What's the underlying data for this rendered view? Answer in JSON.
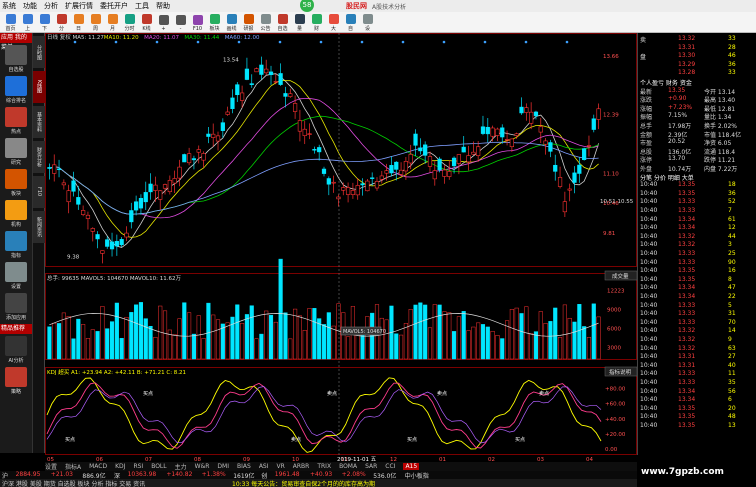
{
  "menubar": {
    "items": [
      "系统",
      "功能",
      "分析",
      "扩展行情",
      "委托开户",
      "工具",
      "帮助"
    ],
    "brand": "股民网",
    "title": "A股技术分析"
  },
  "toolbar": {
    "buttons": [
      "首页",
      "上",
      "下",
      "分",
      "日",
      "周",
      "月",
      "分时",
      "K线",
      "+",
      "-",
      "F10",
      "板块",
      "画线",
      "研报",
      "公告",
      "自选",
      "量",
      "财",
      "大",
      "自",
      "设"
    ]
  },
  "sidebar": {
    "header": "应用 我的菜单",
    "items": [
      "自选股",
      "综合排名",
      "热点",
      "研究",
      "板块",
      "机构",
      "指标",
      "设置",
      "添加应用"
    ],
    "bottom": "精品推荐",
    "apps": [
      "AI分析",
      "策略"
    ]
  },
  "vtabs": [
    "分时图",
    "K线图",
    "基本资料",
    "财务分析",
    "F10",
    "新闻资讯"
  ],
  "chart": {
    "ma_legend": [
      {
        "text": "日线 复权 MA5: 11.27",
        "color": "#d0d0d0"
      },
      {
        "text": "MA10: 11.20",
        "color": "#e6e600"
      },
      {
        "text": "MA20: 11.07",
        "color": "#e04ce0"
      },
      {
        "text": "MA30: 11.44",
        "color": "#00d000"
      },
      {
        "text": "MA60: 12.00",
        "color": "#7f9fff"
      }
    ],
    "price_axis": [
      "13.66",
      "12.39",
      "11.10",
      "10.46",
      "9.81"
    ],
    "high_label": "13.54",
    "low_label": "9.38",
    "low2_label": "10.51 10.55",
    "vol_legend": "总手: 99635  MAVOL5: 104670  MAVOL10: 11.62万",
    "vol_axis": [
      "12223",
      "9000",
      "6000",
      "3000"
    ],
    "vol_tooltip": "MAVOL5: 104670",
    "vol_btn": "成交量",
    "osc_legend": "KDJ 超买  A1: +23.94  A2: +42.11  B: +71.21  C: 8.21",
    "osc_axis": [
      "+80.00",
      "+60.00",
      "+40.00",
      "+20.00",
      "0.00"
    ],
    "osc_btn": "指标说明",
    "date_axis": [
      "05",
      "06",
      "07",
      "08",
      "09",
      "10",
      "11",
      "12",
      "01",
      "02",
      "03",
      "04"
    ],
    "date_tag": "2019-11-01 五",
    "annot": [
      "买点",
      "买点",
      "卖点",
      "卖点",
      "买点",
      "卖点",
      "买点",
      "卖点"
    ]
  },
  "btabs": [
    "设置",
    "指标A",
    "MACD",
    "KDJ",
    "RSI",
    "BOLL",
    "主力",
    "W&R",
    "DMI",
    "BIAS",
    "ASI",
    "VR",
    "ARBR",
    "TRIX",
    "BOMA",
    "SAR",
    "CCI",
    "A15"
  ],
  "rpanel": {
    "title_rows": [
      {
        "l": "卖",
        "v": "13.32",
        "r": "33"
      },
      {
        "l": "",
        "v": "13.31",
        "r": "28"
      },
      {
        "l": "盘",
        "v": "13.30",
        "r": "46"
      },
      {
        "l": "",
        "v": "13.29",
        "r": "36"
      },
      {
        "l": "",
        "v": "13.28",
        "r": "33"
      }
    ],
    "sec_title": "个人盈亏  财务 资金",
    "stats": [
      {
        "l": "最新",
        "v": "13.35",
        "r": "今开 13.14"
      },
      {
        "l": "涨跌",
        "v": "+0.90",
        "r": "最高 13.40"
      },
      {
        "l": "涨幅",
        "v": "+7.23%",
        "r": "最低 12.81"
      },
      {
        "l": "振幅",
        "v": "7.15%",
        "r": "量比 1.34"
      },
      {
        "l": "总手",
        "v": "17.98万",
        "r": "换手 2.02%"
      },
      {
        "l": "金额",
        "v": "2.39亿",
        "r": "市值 118.4亿"
      },
      {
        "l": "市盈",
        "v": "20.52",
        "r": "净资 6.05"
      },
      {
        "l": "总股",
        "v": "136.0亿",
        "r": "流通 118.4"
      },
      {
        "l": "涨停",
        "v": "13.70",
        "r": "跌停 11.21"
      },
      {
        "l": "外盘",
        "v": "10.74万",
        "r": "内盘 7.22万"
      }
    ],
    "ticks": [
      {
        "t": "10:40",
        "p": "13.35",
        "v": "18"
      },
      {
        "t": "10:40",
        "p": "13.35",
        "v": "36"
      },
      {
        "t": "10:40",
        "p": "13.33",
        "v": "52"
      },
      {
        "t": "10:40",
        "p": "13.33",
        "v": "7"
      },
      {
        "t": "10:40",
        "p": "13.34",
        "v": "61"
      },
      {
        "t": "10:40",
        "p": "13.34",
        "v": "12"
      },
      {
        "t": "10:40",
        "p": "13.32",
        "v": "44"
      },
      {
        "t": "10:40",
        "p": "13.32",
        "v": "3"
      },
      {
        "t": "10:40",
        "p": "13.33",
        "v": "25"
      },
      {
        "t": "10:40",
        "p": "13.33",
        "v": "90"
      },
      {
        "t": "10:40",
        "p": "13.35",
        "v": "16"
      },
      {
        "t": "10:40",
        "p": "13.35",
        "v": "8"
      },
      {
        "t": "10:40",
        "p": "13.34",
        "v": "47"
      },
      {
        "t": "10:40",
        "p": "13.34",
        "v": "22"
      },
      {
        "t": "10:40",
        "p": "13.33",
        "v": "5"
      },
      {
        "t": "10:40",
        "p": "13.33",
        "v": "31"
      },
      {
        "t": "10:40",
        "p": "13.33",
        "v": "70"
      },
      {
        "t": "10:40",
        "p": "13.32",
        "v": "14"
      },
      {
        "t": "10:40",
        "p": "13.32",
        "v": "9"
      },
      {
        "t": "10:40",
        "p": "13.32",
        "v": "63"
      },
      {
        "t": "10:40",
        "p": "13.31",
        "v": "27"
      },
      {
        "t": "10:40",
        "p": "13.31",
        "v": "40"
      },
      {
        "t": "10:40",
        "p": "13.33",
        "v": "11"
      },
      {
        "t": "10:40",
        "p": "13.33",
        "v": "35"
      },
      {
        "t": "10:40",
        "p": "13.34",
        "v": "56"
      },
      {
        "t": "10:40",
        "p": "13.34",
        "v": "6"
      },
      {
        "t": "10:40",
        "p": "13.35",
        "v": "20"
      },
      {
        "t": "10:40",
        "p": "13.35",
        "v": "48"
      },
      {
        "t": "10:40",
        "p": "13.35",
        "v": "13"
      }
    ],
    "tick_header": "分笔  分价  明细  大单"
  },
  "statusbar": [
    {
      "text": "沪",
      "color": "#ddd"
    },
    {
      "text": "2884.95",
      "color": "#ff4040"
    },
    {
      "text": "+21.03",
      "color": "#ff4040"
    },
    {
      "text": "886.9亿",
      "color": "#ddd"
    },
    {
      "text": "深",
      "color": "#ddd"
    },
    {
      "text": "10363.98",
      "color": "#ff4040"
    },
    {
      "text": "+140.82",
      "color": "#ff4040"
    },
    {
      "text": "+1.38%",
      "color": "#ff4040"
    },
    {
      "text": "1619亿",
      "color": "#ddd"
    },
    {
      "text": "创",
      "color": "#ddd"
    },
    {
      "text": "1961.48",
      "color": "#ff4040"
    },
    {
      "text": "+40.93",
      "color": "#ff4040"
    },
    {
      "text": "+2.08%",
      "color": "#ff4040"
    },
    {
      "text": "536.0亿",
      "color": "#ddd"
    },
    {
      "text": "中小板指",
      "color": "#ddd"
    }
  ],
  "ticker": {
    "left": "沪深 港股 美股 期货 自选股 板块 分析 指标 交易 资讯",
    "news": "10:33 每天公告：贸易审查自保2个月的的库存高为期",
    "watermark": "www.7gpzb.com"
  },
  "colors": {
    "up": "#ff3232",
    "down": "#00e6ff",
    "ma5": "#d0d0d0",
    "ma10": "#e6e600",
    "ma20": "#e04ce0",
    "ma30": "#00d000",
    "ma60": "#7f9fff"
  }
}
